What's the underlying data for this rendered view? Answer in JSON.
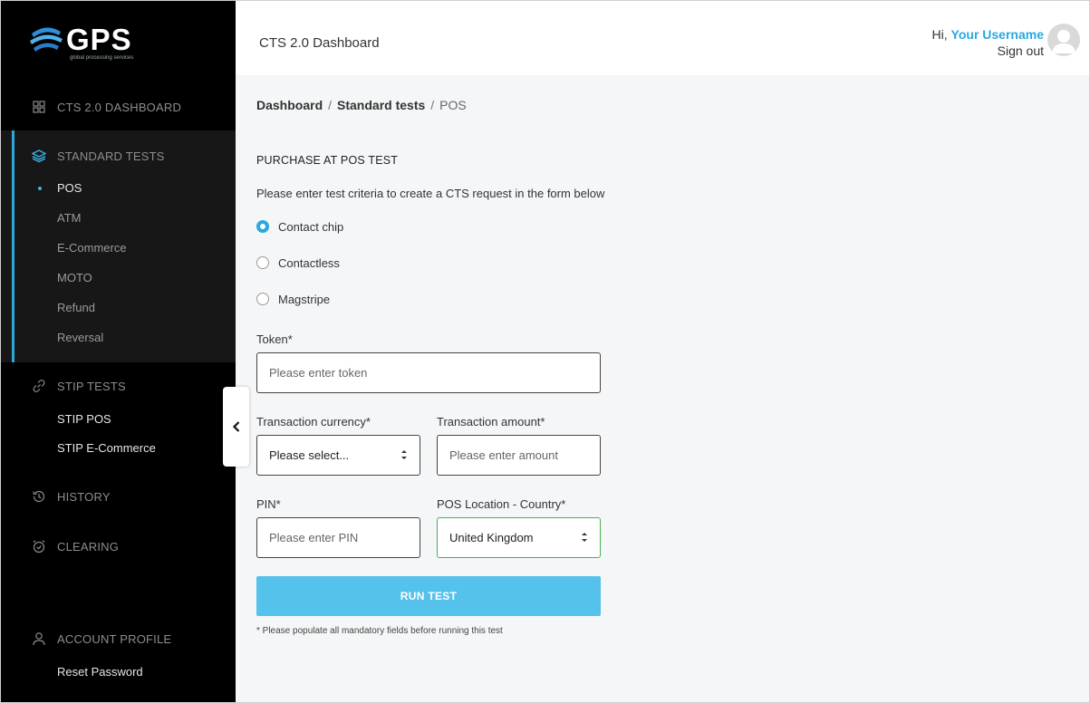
{
  "brand": {
    "logo_text": "GPS",
    "logo_subtitle": "global processing services"
  },
  "sidebar": {
    "dashboard": "CTS 2.0 DASHBOARD",
    "standard_tests": {
      "label": "STANDARD TESTS",
      "items": [
        "POS",
        "ATM",
        "E-Commerce",
        "MOTO",
        "Refund",
        "Reversal"
      ]
    },
    "stip_tests": {
      "label": "STIP TESTS",
      "items": [
        "STIP POS",
        "STIP E-Commerce"
      ]
    },
    "history": "HISTORY",
    "clearing": "CLEARING",
    "account": {
      "label": "ACCOUNT PROFILE",
      "items": [
        "Reset Password"
      ]
    }
  },
  "header": {
    "title": "CTS 2.0 Dashboard",
    "greeting": "Hi, ",
    "username": "Your Username",
    "signout": "Sign out"
  },
  "breadcrumb": {
    "first": "Dashboard",
    "second": "Standard tests",
    "current": "POS",
    "separator": "/"
  },
  "form": {
    "title": "PURCHASE AT POS TEST",
    "instruction": "Please enter test criteria to create a CTS request in the form below",
    "options": [
      "Contact chip",
      "Contactless",
      "Magstripe"
    ],
    "selected_option": "Contact chip",
    "token_label": "Token*",
    "token_placeholder": "Please enter token",
    "currency_label": "Transaction currency*",
    "currency_value": "Please select...",
    "amount_label": "Transaction amount*",
    "amount_placeholder": "Please enter amount",
    "pin_label": "PIN*",
    "pin_placeholder": "Please enter PIN",
    "country_label": "POS Location - Country*",
    "country_value": "United Kingdom",
    "run_label": "RUN TEST",
    "footnote": "* Please populate all mandatory fields before running this test"
  },
  "colors": {
    "accent": "#27a9e1",
    "button": "#55c2ec",
    "sidebar": "#000000",
    "valid": "#4caf50"
  }
}
